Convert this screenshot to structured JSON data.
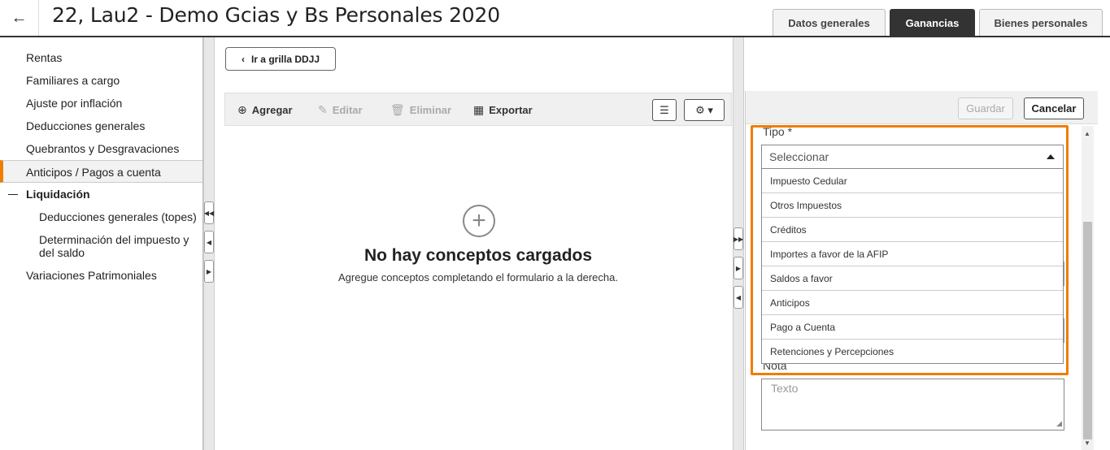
{
  "header": {
    "title": "22, Lau2 - Demo Gcias y Bs Personales 2020",
    "back_icon": "arrow-left-icon",
    "tabs": [
      {
        "label": "Datos generales",
        "active": false
      },
      {
        "label": "Ganancias",
        "active": true
      },
      {
        "label": "Bienes personales",
        "active": false
      }
    ]
  },
  "sidebar": {
    "items": [
      {
        "label": "Rentas"
      },
      {
        "label": "Familiares a cargo"
      },
      {
        "label": "Ajuste por inflación"
      },
      {
        "label": "Deducciones generales"
      },
      {
        "label": "Quebrantos y Desgravaciones"
      },
      {
        "label": "Anticipos / Pagos a cuenta",
        "active": true
      },
      {
        "label": "Liquidación"
      },
      {
        "label": "Deducciones generales (topes)"
      },
      {
        "label": "Determinación del impuesto y del saldo"
      },
      {
        "label": "Variaciones Patrimoniales"
      }
    ]
  },
  "grid_button": {
    "label": "Ir a grilla DDJJ",
    "icon": "chevron-left-icon"
  },
  "toolbar": {
    "add": "Agregar",
    "edit": "Editar",
    "delete": "Eliminar",
    "export": "Exportar"
  },
  "empty_state": {
    "icon": "plus-circle-icon",
    "title": "No hay conceptos cargados",
    "subtitle": "Agregue conceptos completando el formulario a la derecha."
  },
  "form": {
    "save": "Guardar",
    "cancel": "Cancelar",
    "tipo_label": "Tipo *",
    "tipo_placeholder": "Seleccionar",
    "tipo_options": [
      "Impuesto Cedular",
      "Otros Impuestos",
      "Créditos",
      "Importes a favor de la AFIP",
      "Saldos a favor",
      "Anticipos",
      "Pago a Cuenta",
      "Retenciones y Percepciones"
    ],
    "nota_label": "Nota",
    "nota_placeholder": "Texto"
  },
  "colors": {
    "accent": "#ef7d00",
    "active_tab": "#333333"
  }
}
